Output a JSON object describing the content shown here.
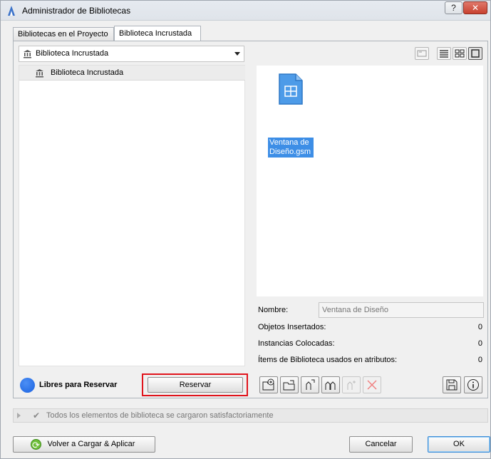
{
  "window": {
    "title": "Administrador de Bibliotecas",
    "help_label": "?",
    "close_label": "✕"
  },
  "tabs": [
    {
      "label": "Bibliotecas en el Proyecto"
    },
    {
      "label": "Biblioteca Incrustada"
    }
  ],
  "library_select": {
    "value": "Biblioteca Incrustada"
  },
  "tree": {
    "items": [
      {
        "label": "Biblioteca Incrustada"
      }
    ]
  },
  "view_buttons": [
    "folder-view-icon",
    "list-view-icon",
    "icon-view-icon",
    "large-icon-view-icon"
  ],
  "preview": {
    "items": [
      {
        "name": "Ventana de Diseño.gsm",
        "icon": "window-object-icon"
      }
    ]
  },
  "details": {
    "name_label": "Nombre:",
    "name_value": "Ventana de Diseño",
    "inserted_label": "Objetos Insertados:",
    "inserted_value": "0",
    "placed_label": "Instancias Colocadas:",
    "placed_value": "0",
    "attrib_label": "Ítems de Biblioteca usados en atributos:",
    "attrib_value": "0"
  },
  "status": {
    "label": "Libres para Reservar",
    "color": "#1a62e0"
  },
  "reserve_button": {
    "label": "Reservar"
  },
  "message": {
    "text": "Todos los elementos de biblioteca se cargaron satisfactoriamente"
  },
  "buttons": {
    "reload": "Volver a Cargar & Aplicar",
    "cancel": "Cancelar",
    "ok": "OK"
  }
}
